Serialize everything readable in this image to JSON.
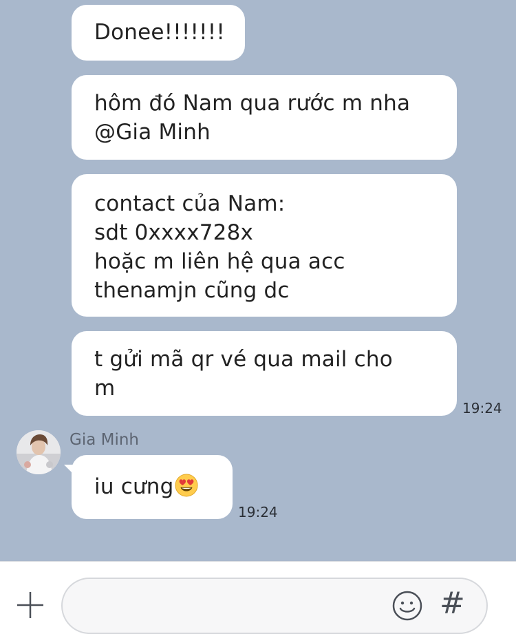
{
  "messages": [
    {
      "text": "Donee!!!!!!!"
    },
    {
      "text": "hôm đó Nam qua rước m nha\n@Gia Minh"
    },
    {
      "text": "contact của Nam:\nsdt 0xxxx728x\nhoặc m liên hệ qua acc\nthenamjn cũng dc"
    },
    {
      "text": "t gửi mã qr vé qua mail cho\nm",
      "time": "19:24"
    },
    {
      "sender": "Gia Minh",
      "text": "iu cưng",
      "emoji": "heart-eyes-emoji",
      "time": "19:24"
    }
  ],
  "input": {
    "value": "",
    "placeholder": "",
    "hash_symbol": "#",
    "icons": [
      "plus-icon",
      "smile-icon"
    ]
  },
  "colors": {
    "chat_background": "#a9b8cc",
    "bubble": "#ffffff",
    "input_bar": "#ffffff"
  }
}
